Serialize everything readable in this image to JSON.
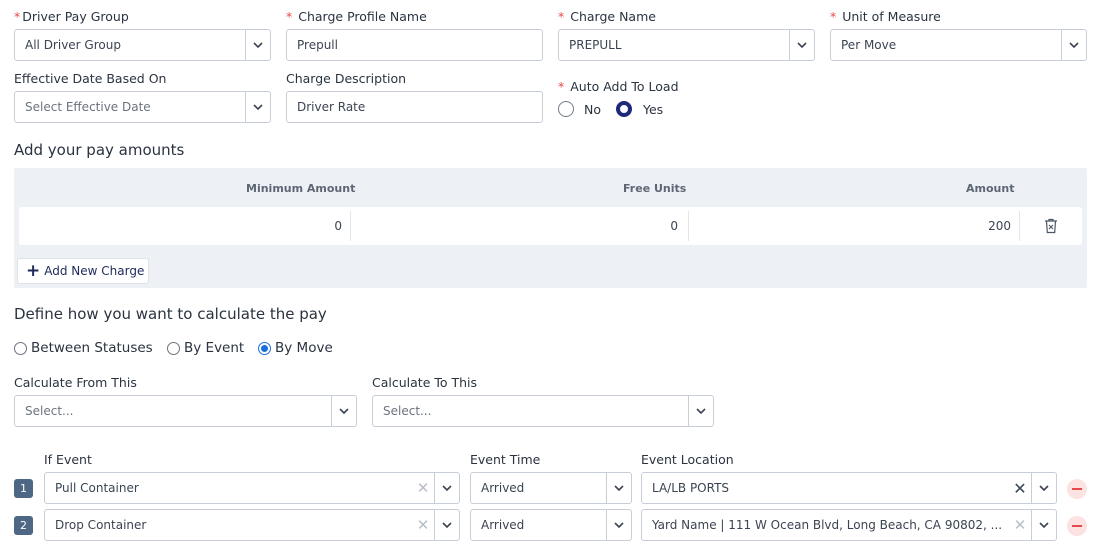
{
  "charge_form": {
    "driver_pay_group": {
      "label": "Driver Pay Group",
      "value": "All Driver Group"
    },
    "charge_profile_name": {
      "label": "Charge Profile Name",
      "value": "Prepull"
    },
    "charge_name": {
      "label": "Charge Name",
      "value": "PREPULL"
    },
    "unit_of_measure": {
      "label": "Unit of Measure",
      "value": "Per Move"
    },
    "effective_date": {
      "label": "Effective Date Based On",
      "placeholder": "Select Effective Date"
    },
    "charge_description": {
      "label": "Charge Description",
      "value": "Driver Rate"
    },
    "auto_add": {
      "label": "Auto Add To Load",
      "options": [
        "No",
        "Yes"
      ],
      "selected": "Yes"
    },
    "required_marker": "*"
  },
  "pay_amounts": {
    "title": "Add your pay amounts",
    "columns": [
      "Minimum Amount",
      "Free Units",
      "Amount"
    ],
    "rows": [
      {
        "minimum_amount": "0",
        "free_units": "0",
        "amount": "200"
      }
    ],
    "add_button": "Add New Charge"
  },
  "calculation": {
    "title": "Define how you want to calculate the pay",
    "methods": [
      "Between Statuses",
      "By Event",
      "By Move"
    ],
    "selected_method": "By Move",
    "from": {
      "label": "Calculate From This",
      "placeholder": "Select..."
    },
    "to": {
      "label": "Calculate To This",
      "placeholder": "Select..."
    }
  },
  "events": {
    "headers": {
      "event": "If Event",
      "time": "Event Time",
      "location": "Event Location"
    },
    "rows": [
      {
        "number": "1",
        "event": "Pull Container",
        "time": "Arrived",
        "location": "LA/LB PORTS"
      },
      {
        "number": "2",
        "event": "Drop Container",
        "time": "Arrived",
        "location": "Yard Name | 111 W Ocean Blvd, Long Beach, CA 90802, ..."
      }
    ]
  },
  "icons": {
    "chevron": "chevron-down-icon",
    "clear": "clear-icon",
    "delete": "delete-row-icon",
    "plus": "plus-icon",
    "minus": "remove-row-icon"
  },
  "colors": {
    "accent": "#1d2a7a",
    "required": "#e5484d",
    "panel": "#edf1f6",
    "badge": "#4e6785"
  }
}
